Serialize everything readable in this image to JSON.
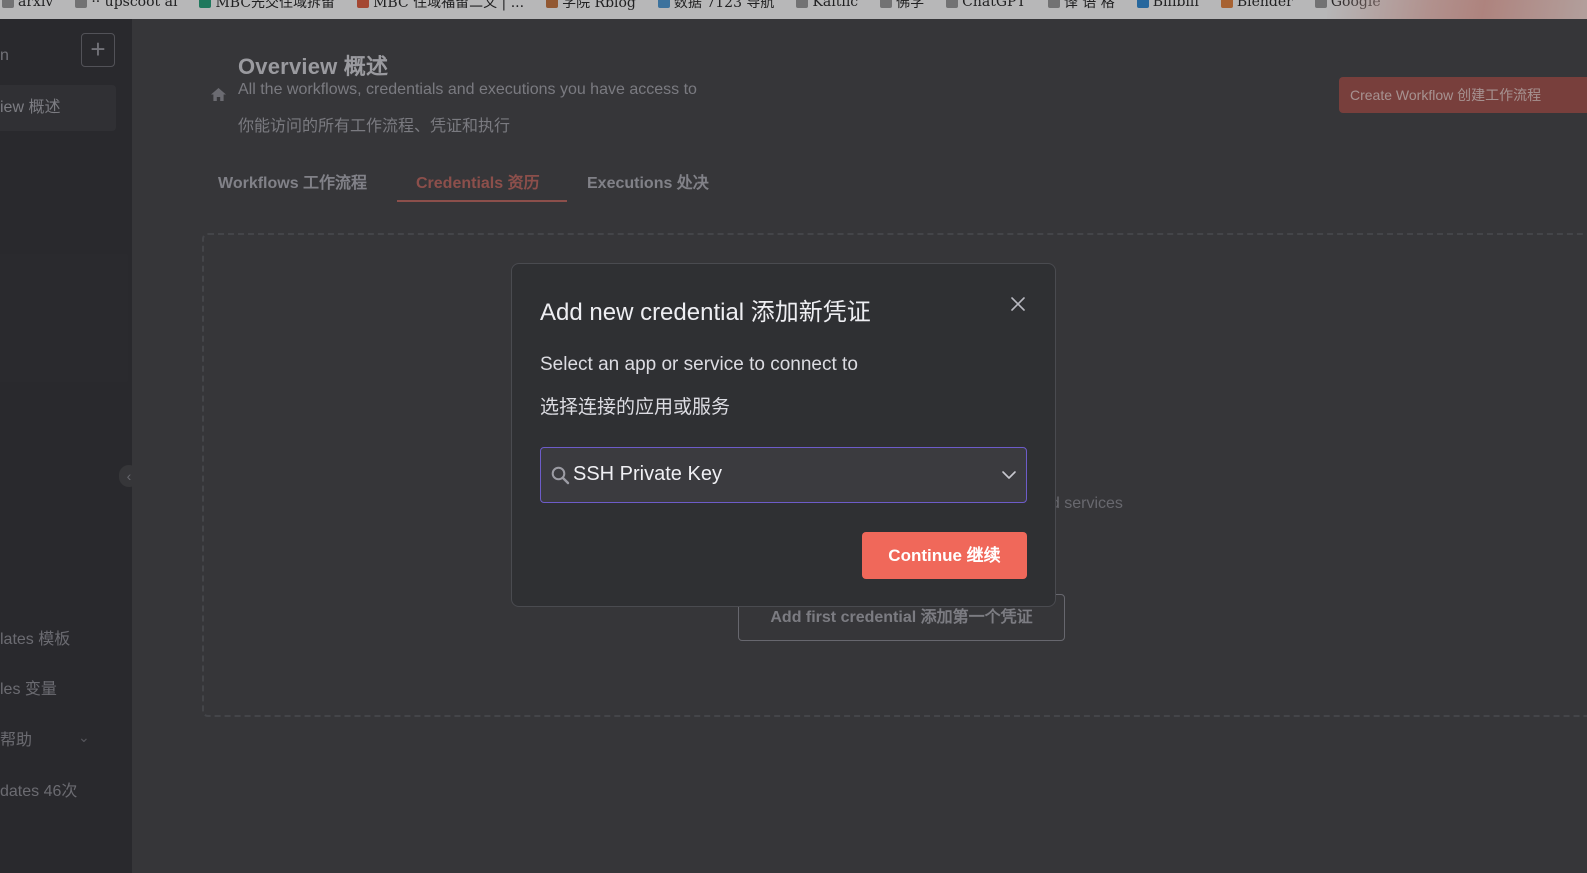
{
  "bookmarks": [
    {
      "label": "arxiv",
      "color": "#9a9a9a"
    },
    {
      "label": "·· upscoot ai",
      "color": "#9a9a9a"
    },
    {
      "label": "MBC先交住域拆留",
      "color": "#1fa37a"
    },
    {
      "label": "MBC 住域福留二文 | ...",
      "color": "#e45a3a"
    },
    {
      "label": "学院 Rblog",
      "color": "#c9743a"
    },
    {
      "label": "数据 7123 导航",
      "color": "#4a9ad8"
    },
    {
      "label": "Kaitlic",
      "color": "#9a9a9a"
    },
    {
      "label": "佛学",
      "color": "#9a9a9a"
    },
    {
      "label": "ChatGPT",
      "color": "#9a9a9a"
    },
    {
      "label": "译 语 格",
      "color": "#9a9a9a"
    },
    {
      "label": "Bilibili",
      "color": "#2a8ad8"
    },
    {
      "label": "Blender",
      "color": "#e8823a"
    },
    {
      "label": "Google",
      "color": "#9a9a9a"
    }
  ],
  "sidebar": {
    "partial_top": "n",
    "active_item": "iew  概述",
    "items": [
      {
        "label": "lates  模板"
      },
      {
        "label": "les  变量"
      },
      {
        "label": "帮助"
      },
      {
        "label": "dates  46次"
      }
    ]
  },
  "header": {
    "title": "Overview  概述",
    "subtitle_en": "All the workflows, credentials and executions you have access to",
    "subtitle_zh": "你能访问的所有工作流程、凭证和执行",
    "create_button": "Create Workflow  创建工作流程"
  },
  "tabs": [
    {
      "label": "Workflows  工作流程",
      "active": false
    },
    {
      "label": "Credentials  资历",
      "active": true
    },
    {
      "label": "Executions  处决",
      "active": false
    }
  ],
  "empty_state": {
    "text_partial": "nd services",
    "button": "Add first credential  添加第一个凭证"
  },
  "modal": {
    "title": "Add new credential  添加新凭证",
    "label_en": "Select an app or service to connect to",
    "label_zh": "选择连接的应用或服务",
    "select_value": "SSH Private Key",
    "continue_button": "Continue  继续"
  },
  "colors": {
    "accent": "#f0685a",
    "focus_border": "#6d5cc9",
    "modal_bg": "#2f3033",
    "page_bg": "#414244"
  },
  "icons": {
    "home": "home-icon",
    "close": "close-icon",
    "search": "search-icon",
    "chevron": "chevron-down-icon",
    "add": "plus-icon"
  }
}
